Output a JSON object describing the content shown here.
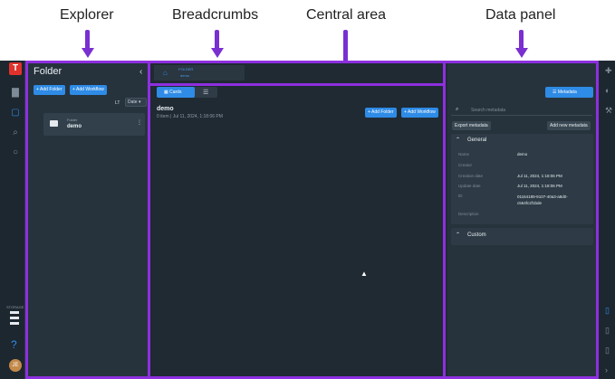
{
  "annotations": {
    "explorer": "Explorer",
    "breadcrumbs": "Breadcrumbs",
    "central": "Central area",
    "datapanel": "Data panel"
  },
  "rail": {
    "logo": "T",
    "storage": "STORAGE",
    "help": "?",
    "avatar": "JE"
  },
  "explorer": {
    "title": "Folder",
    "add_folder": "+ Add Folder",
    "add_workflow": "+ Add Workflow",
    "lt": "LT",
    "sort": "Date",
    "item": {
      "type": "Folder",
      "name": "demo"
    }
  },
  "breadcrumb": {
    "type": "FOLDER",
    "name": "demo"
  },
  "central": {
    "view_cards": "Cards",
    "add_folder": "+ Add Folder",
    "add_workflow": "+ Add Workflow",
    "title": "demo",
    "meta": "0 item  |  Jul 11, 2024, 1:18:06 PM"
  },
  "datapanel": {
    "metadata_button": "Metadata",
    "search_placeholder": "Search metadata",
    "export": "Export metadata",
    "add_new": "Add new metadata",
    "general": {
      "title": "General",
      "fields": [
        {
          "k": "Name",
          "v": "demo"
        },
        {
          "k": "Creator",
          "v": ""
        },
        {
          "k": "Creation date",
          "v": "Jul 11, 2024, 1:18:06 PM"
        },
        {
          "k": "Update date",
          "v": "Jul 11, 2024, 1:18:06 PM"
        },
        {
          "k": "ID",
          "v": "01164189-9107-40a3-a8d0-c564fc2f1bde"
        },
        {
          "k": "Description",
          "v": ""
        }
      ]
    },
    "custom": {
      "title": "Custom"
    }
  },
  "colors": {
    "accent": "#2e8be6",
    "highlight": "#8e2fe0",
    "logo": "#e0322d"
  }
}
